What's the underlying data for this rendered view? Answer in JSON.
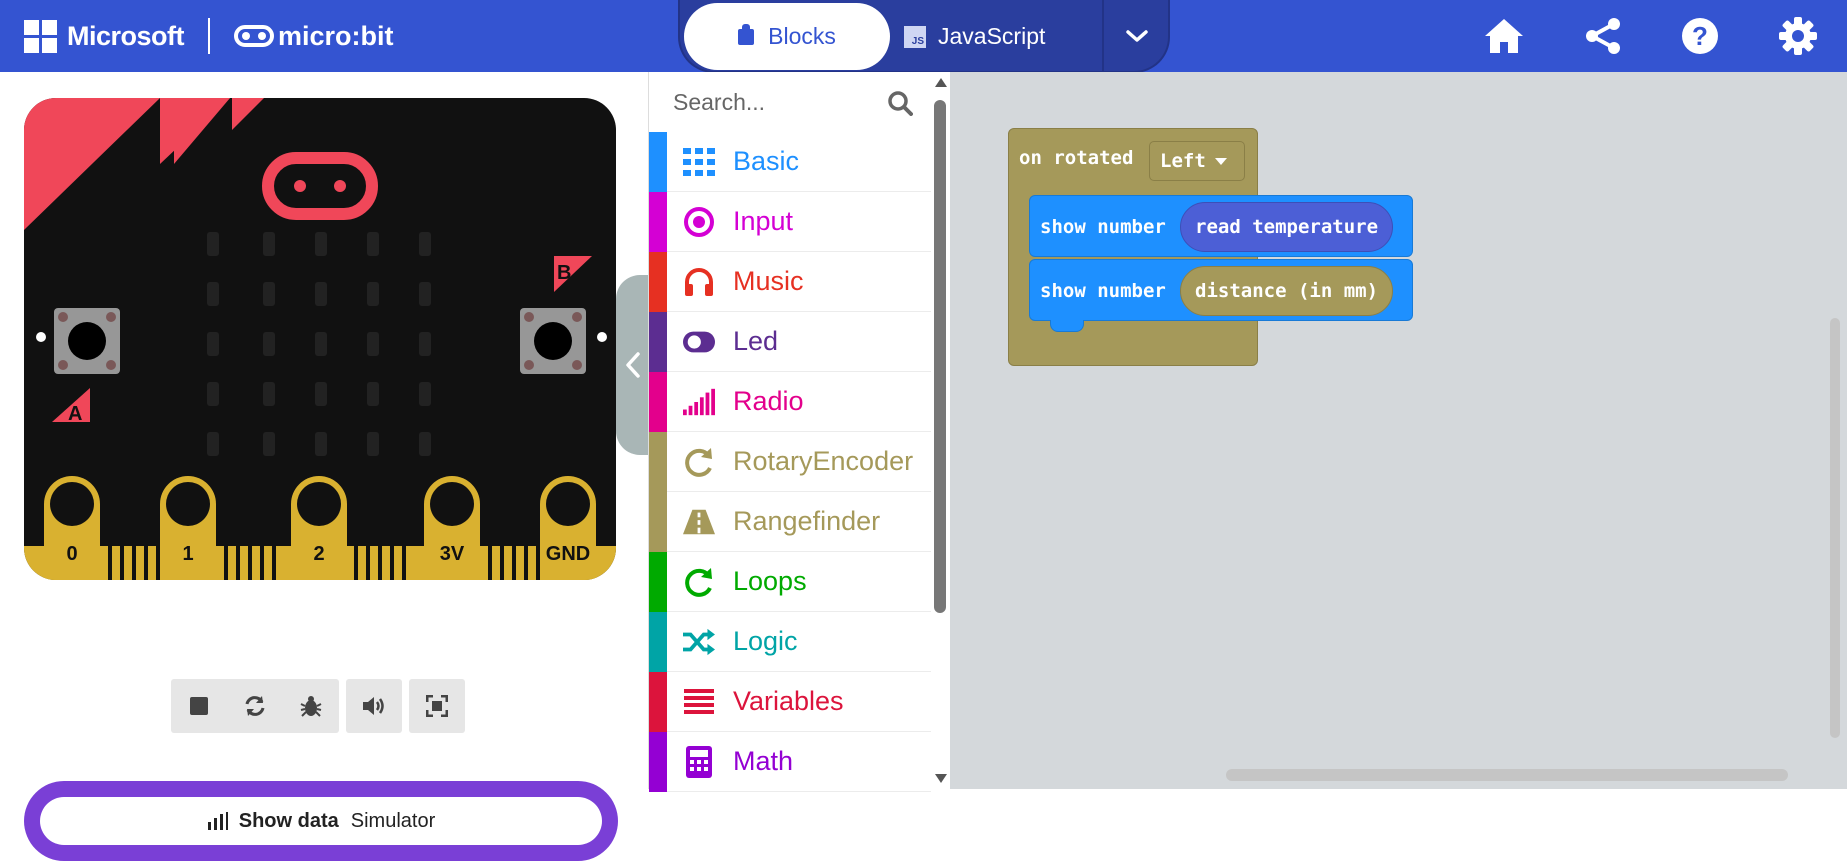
{
  "header": {
    "brand": "Microsoft",
    "product": "micro:bit",
    "tabs": [
      {
        "label": "Blocks",
        "active": true
      },
      {
        "label": "JavaScript",
        "active": false
      }
    ],
    "js_badge": "JS",
    "buttons": [
      "home-icon",
      "share-icon",
      "help-icon",
      "settings-icon"
    ],
    "color": "#3454d1"
  },
  "simulator": {
    "button_a": "A",
    "button_b": "B",
    "pins": [
      "0",
      "1",
      "2",
      "3V",
      "GND"
    ],
    "controls": [
      "stop-icon",
      "restart-icon",
      "debug-icon",
      "sound-icon",
      "fullscreen-icon"
    ],
    "show_data_label": "Show data",
    "show_data_target": "Simulator"
  },
  "toolbox": {
    "search_placeholder": "Search...",
    "categories": [
      {
        "label": "Basic",
        "color": "#1e90ff",
        "icon": "grid-icon"
      },
      {
        "label": "Input",
        "color": "#d400d4",
        "icon": "input-icon"
      },
      {
        "label": "Music",
        "color": "#e63022",
        "icon": "headphones-icon"
      },
      {
        "label": "Led",
        "color": "#5c2d91",
        "icon": "toggle-icon"
      },
      {
        "label": "Radio",
        "color": "#e3008c",
        "icon": "signal-icon"
      },
      {
        "label": "RotaryEncoder",
        "color": "#a5995a",
        "icon": "rotate-icon"
      },
      {
        "label": "Rangefinder",
        "color": "#a5995a",
        "icon": "road-icon"
      },
      {
        "label": "Loops",
        "color": "#00aa00",
        "icon": "loop-icon"
      },
      {
        "label": "Logic",
        "color": "#00a4a6",
        "icon": "shuffle-icon"
      },
      {
        "label": "Variables",
        "color": "#dc143c",
        "icon": "list-icon"
      },
      {
        "label": "Math",
        "color": "#9400d3",
        "icon": "calculator-icon"
      }
    ]
  },
  "workspace": {
    "event_block": {
      "label": "on rotated",
      "dropdown_value": "Left",
      "color": "#a5995a"
    },
    "statements": [
      {
        "label": "show number",
        "arg": "read temperature",
        "arg_color": "#4c5fd6"
      },
      {
        "label": "show number",
        "arg": "distance (in mm)",
        "arg_color": "#a5995a"
      }
    ]
  }
}
